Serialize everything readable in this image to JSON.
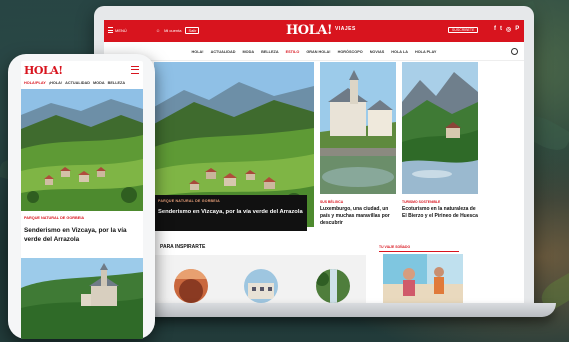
{
  "laptop": {
    "topbar": {
      "menu_label": "MENÚ",
      "account_label": "Mi cuenta",
      "login_label": "Salir",
      "logo": "HOLA!",
      "logo_suffix": "VIAJES",
      "subscribe_label": "SUSCRÍBETE",
      "social": [
        "f",
        "t",
        "◎",
        "P"
      ]
    },
    "nav": [
      "HOLA!",
      "ACTUALIDAD",
      "MODA",
      "BELLEZA",
      "ESTILO",
      "GRAN HOLA!",
      "HORÓSCOPO",
      "NOVIAS",
      "HOLA LA",
      "HOLA PLAY"
    ],
    "nav_active_index": 4,
    "hero": {
      "kicker": "PARQUE NATURAL DE GORBEIA",
      "title": "Senderismo en Vizcaya, por la vía verde del Arrazola"
    },
    "cards": [
      {
        "kicker": "SUS BÉLGICA",
        "title": "Luxemburgo, una ciudad, un país y muchas maravillas por descubrir"
      },
      {
        "kicker": "TURISMO SOSTENIBLE",
        "title": "Ecoturismo en la naturaleza de El Bierzo y el Pirineo de Huesca"
      }
    ],
    "section": {
      "title": "PARA INSPIRARTE"
    },
    "best": {
      "kicker": "TU VIAJE SOÑADO"
    }
  },
  "phone": {
    "logo": "HOLA!",
    "nav": [
      "HOLA!PLAY",
      "¡HOLA!",
      "ACTUALIDAD",
      "MODA",
      "BELLEZA"
    ],
    "hero": {
      "kicker": "PARQUE NATURAL DE GORBEIA",
      "title": "Senderismo en Vizcaya, por la vía verde del Arrazola"
    }
  },
  "colors": {
    "brand_red": "#d8141e",
    "caption_bg": "#111111"
  }
}
